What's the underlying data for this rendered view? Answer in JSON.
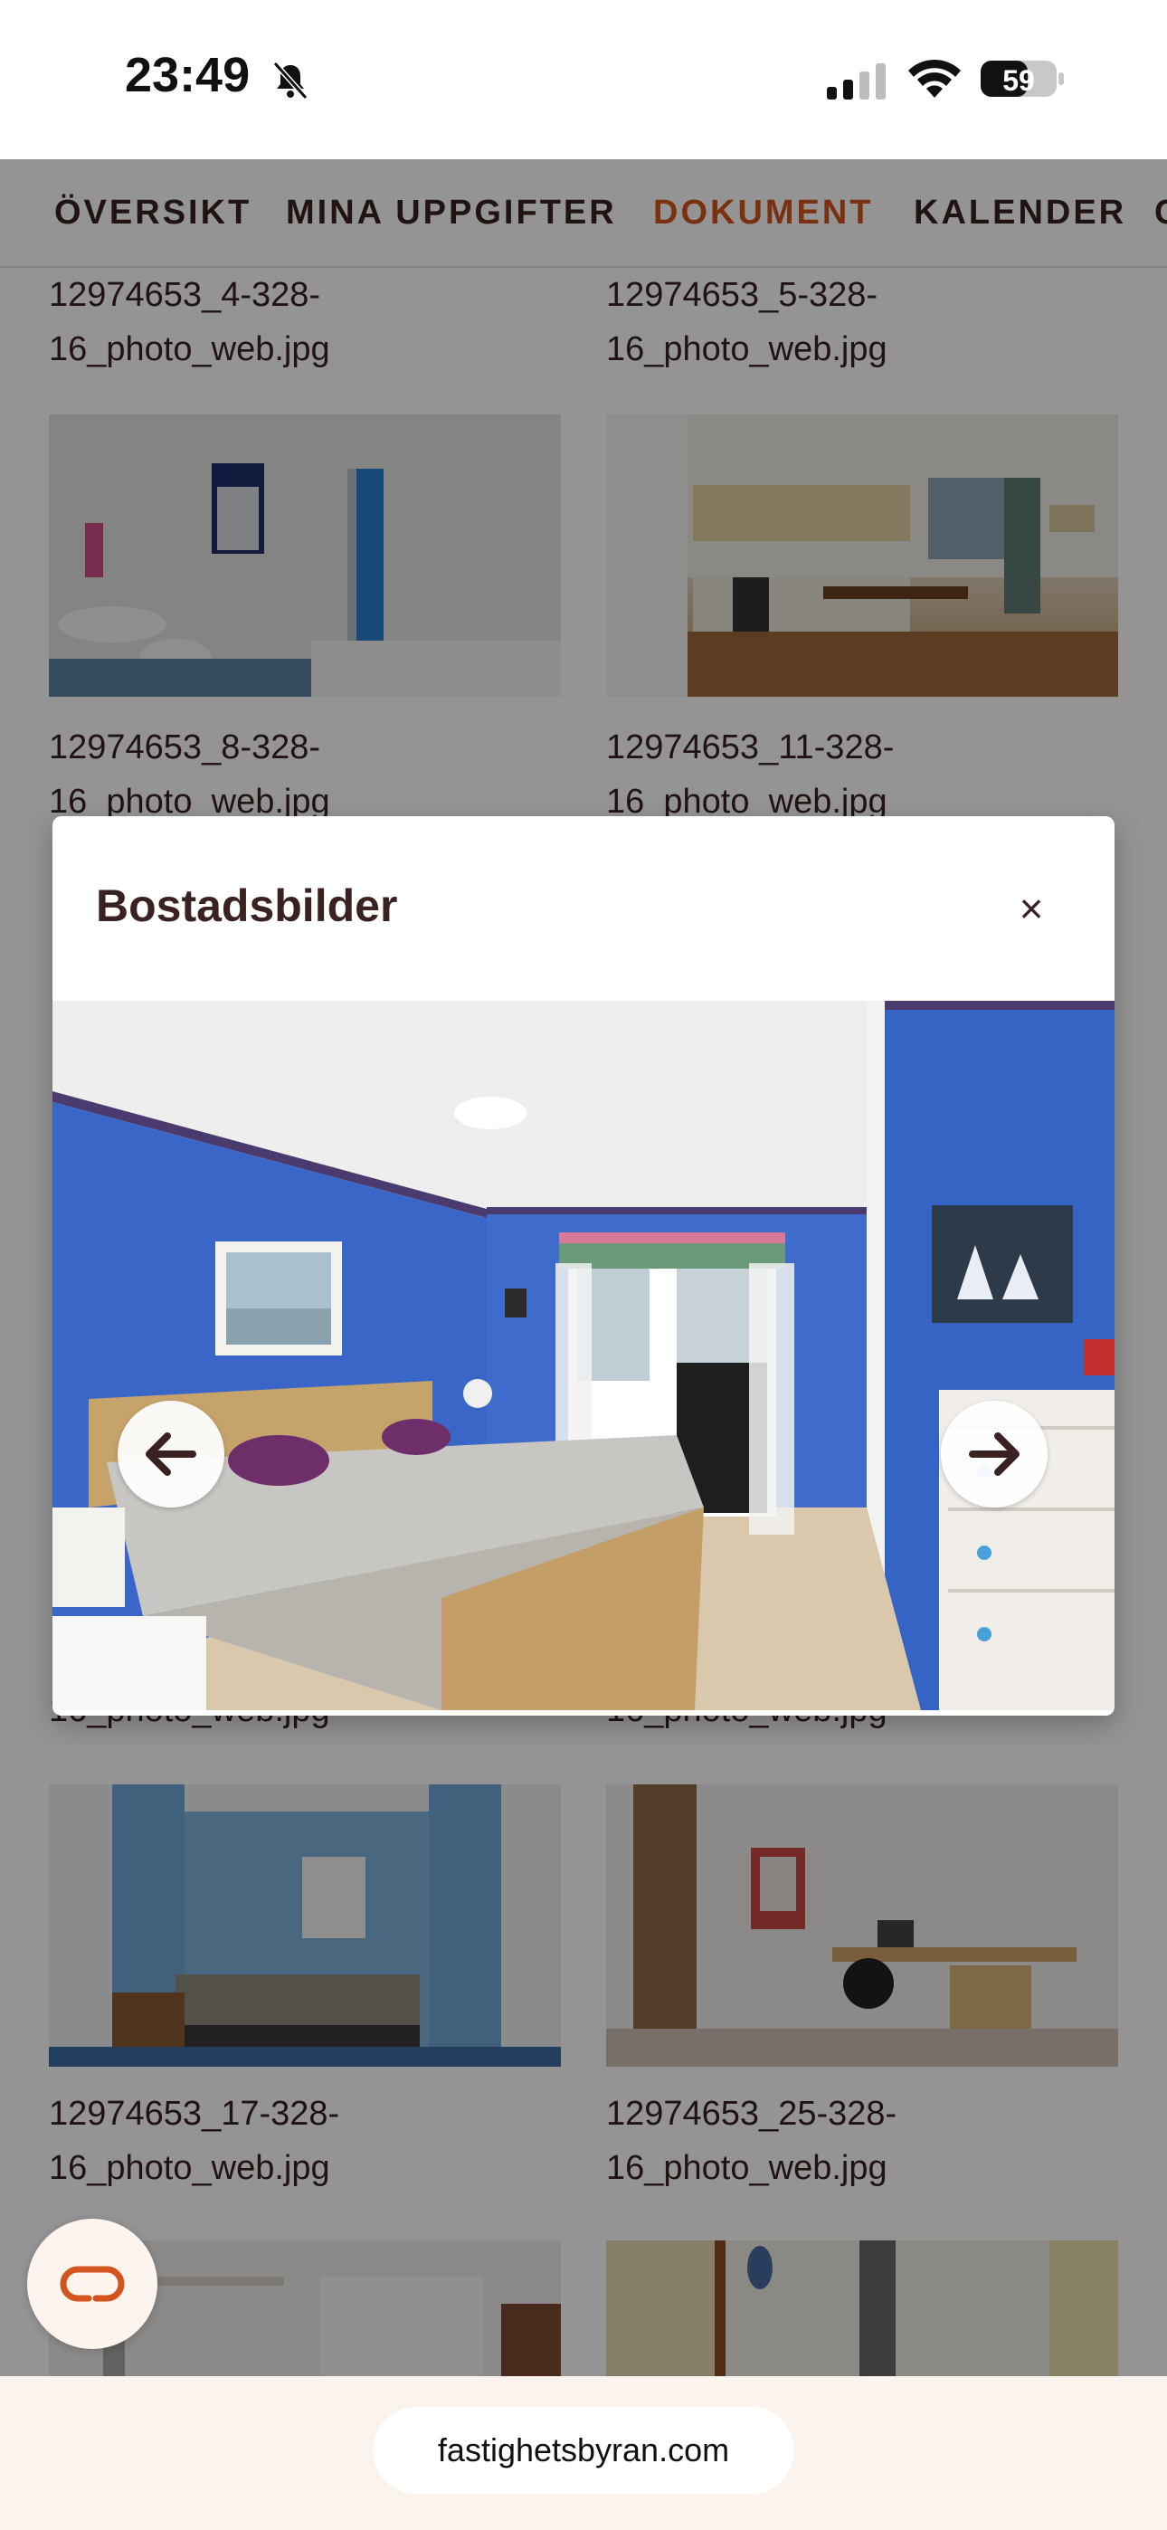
{
  "status_bar": {
    "time": "23:49",
    "battery": "59"
  },
  "nav": {
    "tabs": [
      {
        "label": "ÖVERSIKT",
        "active": false
      },
      {
        "label": "MINA UPPGIFTER",
        "active": false
      },
      {
        "label": "DOKUMENT",
        "active": true
      },
      {
        "label": "KALENDER",
        "active": false
      }
    ]
  },
  "documents": [
    {
      "name": "12974653_4-328-16_photo_web.jpg"
    },
    {
      "name": "12974653_5-328-16_photo_web.jpg"
    },
    {
      "name": "12974653_8-328-16_photo_web.jpg",
      "icon": "bathroom-photo"
    },
    {
      "name": "12974653_11-328-16_photo_web.jpg",
      "icon": "kitchen-photo"
    },
    {
      "name_partial": "16_photo_web.jpg"
    },
    {
      "name_partial": "16_photo_web.jpg"
    },
    {
      "name": "12974653_17-328-16_photo_web.jpg",
      "icon": "bedroom-photo"
    },
    {
      "name": "12974653_25-328-16_photo_web.jpg",
      "icon": "office-photo"
    }
  ],
  "modal": {
    "title": "Bostadsbilder",
    "close_symbol": "×",
    "current_image": "bedroom-photo",
    "prev_icon": "arrow-left-icon",
    "next_icon": "arrow-right-icon"
  },
  "browser": {
    "url": "fastighetsbyran.com"
  },
  "colors": {
    "accent": "#d2551e",
    "text": "#3b2222",
    "wall_blue": "#3a66c7"
  }
}
